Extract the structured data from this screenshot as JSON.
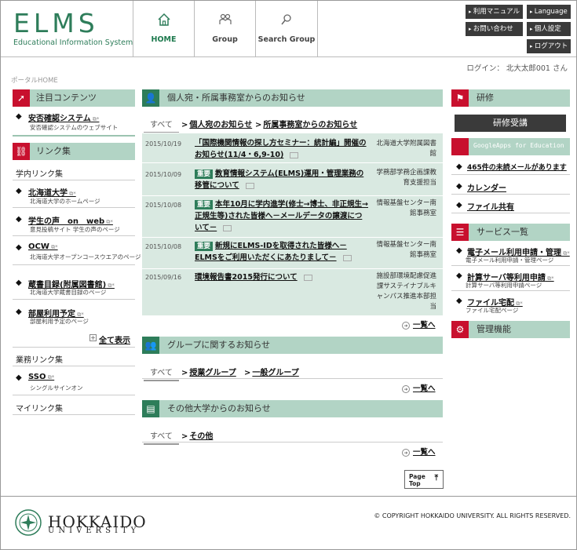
{
  "header": {
    "logo": "ELMS",
    "logo_sub": "Educational Information System",
    "nav": [
      {
        "label": "HOME"
      },
      {
        "label": "Group"
      },
      {
        "label": "Search Group"
      }
    ],
    "util": [
      {
        "label": "利用マニュアル"
      },
      {
        "label": "Language"
      },
      {
        "label": "お問い合わせ"
      },
      {
        "label": "個人設定"
      },
      {
        "label": "ログアウト"
      }
    ]
  },
  "login_text": "ログイン： 北大太郎001 さん",
  "breadcrumb": "ポータルHOME",
  "left": {
    "featured_title": "注目コンテンツ",
    "featured": {
      "label": "安否確認システム",
      "sub": "安否確認システムのウェブサイト"
    },
    "links_title": "リンク集",
    "campus_title": "学内リンク集",
    "campus_links": [
      {
        "label": "北海道大学",
        "sub": "北海道大学のホームページ"
      },
      {
        "label": "学生の声　on　web",
        "sub": "意見投稿サイト 学生の声のページ"
      },
      {
        "label": "OCW",
        "sub": "北海道大学オープンコースウエアのページ"
      },
      {
        "label": "蔵書目録(附属図書館)",
        "sub": "北海道大学蔵書目録のページ"
      },
      {
        "label": "部屋利用予定",
        "sub": "部屋利用予定のページ"
      }
    ],
    "show_all": "全て表示",
    "work_title": "業務リンク集",
    "work_links": [
      {
        "label": "SSO",
        "sub": "シングルサインオン"
      }
    ],
    "my_title": "マイリンク集"
  },
  "middle": {
    "sec1_title": "個人宛・所属事務室からのお知らせ",
    "sec1_tab_all": "すべて",
    "sec1_tabs": [
      "個人宛のお知らせ",
      "所属事務室からのお知らせ"
    ],
    "news": [
      {
        "date": "2015/10/19",
        "badge": "",
        "title": "「国際機関情報の探し方セミナー：統計編」開催のお知らせ(11/4・6,9-10)",
        "source": "北海道大学附属図書館"
      },
      {
        "date": "2015/10/09",
        "badge": "重要",
        "title": "教育情報システム(ELMS)運用・管理業務の移管について",
        "source": "学務部学務企画課教育支援担当"
      },
      {
        "date": "2015/10/08",
        "badge": "重要",
        "title": "本年10月に学内進学(修士→博士、非正規生→正規生等)された皆様へ－メールデータの譲渡について－",
        "source": "情報基盤センター南館事務室"
      },
      {
        "date": "2015/10/08",
        "badge": "重要",
        "title": "新規にELMS-IDを取得された皆様へ－ELMSをご利用いただくにあたりまして－",
        "source": "情報基盤センター南館事務室"
      },
      {
        "date": "2015/09/16",
        "badge": "",
        "title": "環境報告書2015発行について",
        "source": "施設部環境配慮促進課サステイナブルキャンパス推進本部担当"
      }
    ],
    "more": "一覧へ",
    "sec2_title": "グループに関するお知らせ",
    "sec2_tab_all": "すべて",
    "sec2_tabs": [
      "授業グループ",
      "一般グループ"
    ],
    "sec3_title": "その他大学からのお知らせ",
    "sec3_tab_all": "すべて",
    "sec3_tabs": [
      "その他"
    ]
  },
  "right": {
    "kenshu_title": "研修",
    "kenshu_button": "研修受講",
    "gapps_title": "GoogleApps for Education",
    "gapps_links": [
      "465件の未読メールがあります",
      "カレンダー",
      "ファイル共有"
    ],
    "service_title": "サービス一覧",
    "services": [
      {
        "label": "電子メール利用申請・管理",
        "sub": "電子メール利用申請・管理ページ"
      },
      {
        "label": "計算サーバ等利用申請",
        "sub": "計算サーバ等利用申請ページ"
      },
      {
        "label": "ファイル宅配",
        "sub": "ファイル宅配ページ"
      }
    ],
    "admin_title": "管理機能"
  },
  "pagetop": "Page\nTop",
  "footer": {
    "name": "HOKKAIDO",
    "univ": "UNIVERSITY",
    "copyright": "© COPYRIGHT HOKKAIDO UNIVERSITY. ALL RIGHTS RESERVED."
  },
  "colors": {
    "accent_green": "#2e7d5a",
    "panel_green": "#b2d4c5",
    "red": "#c8102e",
    "dark": "#3a3a3a"
  }
}
